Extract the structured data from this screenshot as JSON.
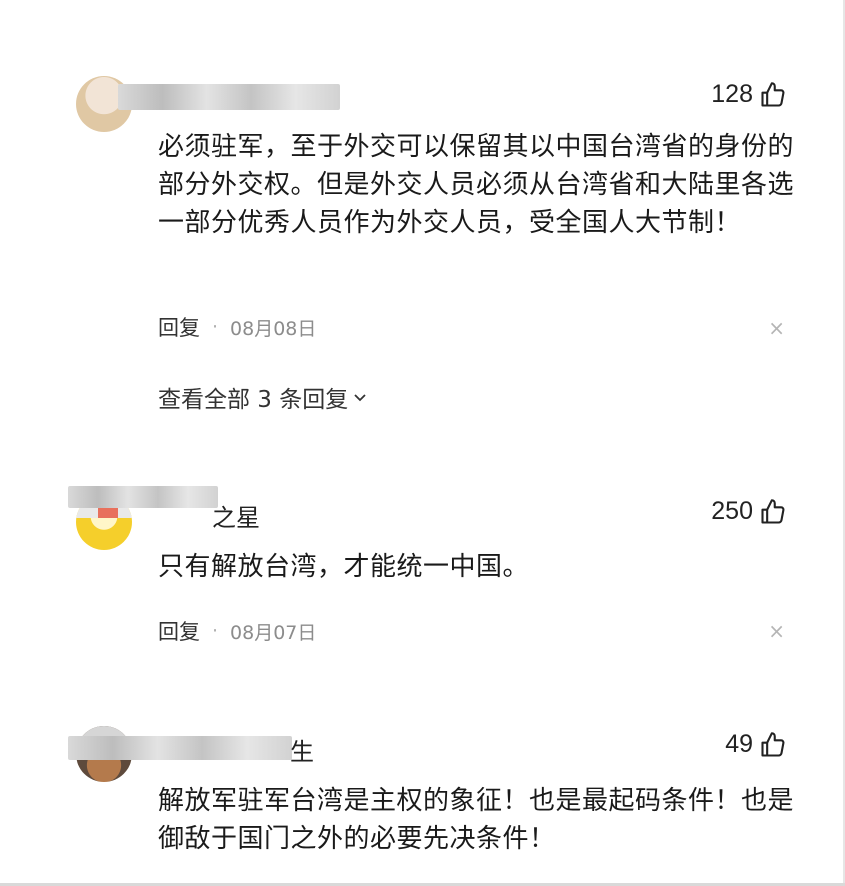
{
  "comments": [
    {
      "username_visible": "",
      "likes": "128",
      "text": "必须驻军，至于外交可以保留其以中国台湾省的身份的部分外交权。但是外交人员必须从台湾省和大陆里各选一部分优秀人员作为外交人员，受全国人大节制！",
      "reply_label": "回复",
      "date": "08月08日",
      "close_symbol": "×",
      "view_replies": "查看全部 3 条回复"
    },
    {
      "username_visible": "之星",
      "likes": "250",
      "text": "只有解放台湾，才能统一中国。",
      "reply_label": "回复",
      "date": "08月07日",
      "close_symbol": "×"
    },
    {
      "username_visible": "生",
      "likes": "49",
      "text": "解放军驻军台湾是主权的象征！也是最起码条件！也是御敌于国门之外的必要先决条件！"
    }
  ],
  "separator": "·",
  "icons": {
    "like": "thumbs-up-icon",
    "chevron": "chevron-down-icon",
    "close": "close-icon"
  }
}
